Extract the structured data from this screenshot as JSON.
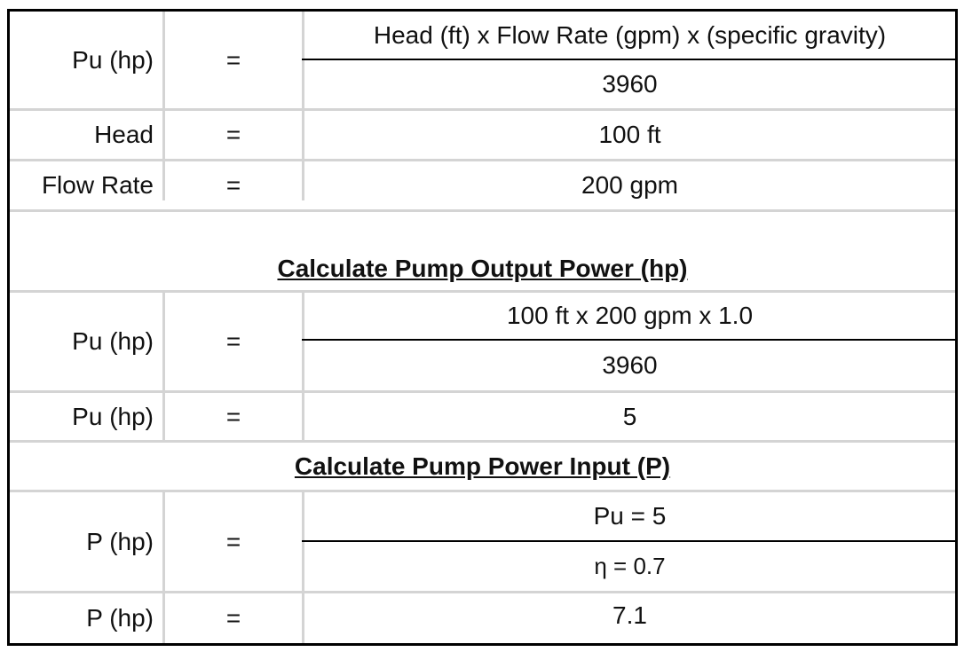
{
  "section1": {
    "formula": {
      "label": "Pu (hp)",
      "eq": "=",
      "numerator": "Head (ft) x Flow Rate (gpm) x (specific gravity)",
      "denominator": "3960"
    },
    "head": {
      "label": "Head",
      "eq": "=",
      "value": "100 ft"
    },
    "flow": {
      "label": "Flow Rate",
      "eq": "=",
      "value": "200 gpm"
    }
  },
  "section2": {
    "title": "Calculate Pump Output Power (hp)",
    "formula": {
      "label": "Pu (hp)",
      "eq": "=",
      "numerator": "100 ft x 200 gpm  x 1.0",
      "denominator": "3960"
    },
    "result": {
      "label": "Pu (hp)",
      "eq": "=",
      "value": "5"
    }
  },
  "section3": {
    "title": "Calculate Pump Power Input (P)",
    "formula": {
      "label": "P (hp)",
      "eq": "=",
      "numerator": "Pu = 5",
      "denominator": "η = 0.7"
    },
    "result": {
      "label": "P (hp)",
      "eq": "=",
      "value": "7.1"
    }
  }
}
